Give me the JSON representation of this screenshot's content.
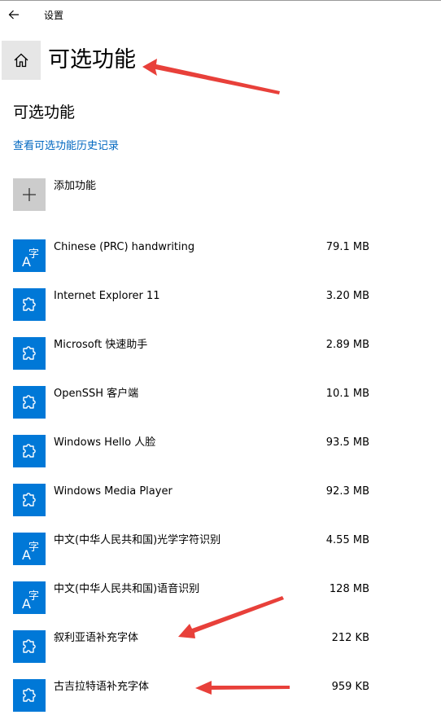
{
  "window": {
    "title": "设置",
    "back_icon": "arrow-left-icon"
  },
  "header": {
    "home_icon": "home-icon",
    "title": "可选功能"
  },
  "section": {
    "title": "可选功能",
    "history_link": "查看可选功能历史记录"
  },
  "add_feature": {
    "icon": "plus-icon",
    "label": "添加功能"
  },
  "features": [
    {
      "icon": "language-icon",
      "name": "Chinese (PRC) handwriting",
      "size": "79.1 MB"
    },
    {
      "icon": "puzzle-icon",
      "name": "Internet Explorer 11",
      "size": "3.20 MB"
    },
    {
      "icon": "puzzle-icon",
      "name": "Microsoft 快速助手",
      "size": "2.89 MB"
    },
    {
      "icon": "puzzle-icon",
      "name": "OpenSSH 客户端",
      "size": "10.1 MB"
    },
    {
      "icon": "puzzle-icon",
      "name": "Windows Hello 人脸",
      "size": "93.5 MB"
    },
    {
      "icon": "puzzle-icon",
      "name": "Windows Media Player",
      "size": "92.3 MB"
    },
    {
      "icon": "language-icon",
      "name": "中文(中华人民共和国)光学字符识别",
      "size": "4.55 MB"
    },
    {
      "icon": "language-icon",
      "name": "中文(中华人民共和国)语音识别",
      "size": "128 MB"
    },
    {
      "icon": "puzzle-icon",
      "name": "叙利亚语补充字体",
      "size": "212 KB"
    },
    {
      "icon": "puzzle-icon",
      "name": "古吉拉特语补充字体",
      "size": "959 KB"
    }
  ],
  "colors": {
    "accent": "#0078d7",
    "link": "#0067c0",
    "annotation_arrow": "#e8403a"
  }
}
